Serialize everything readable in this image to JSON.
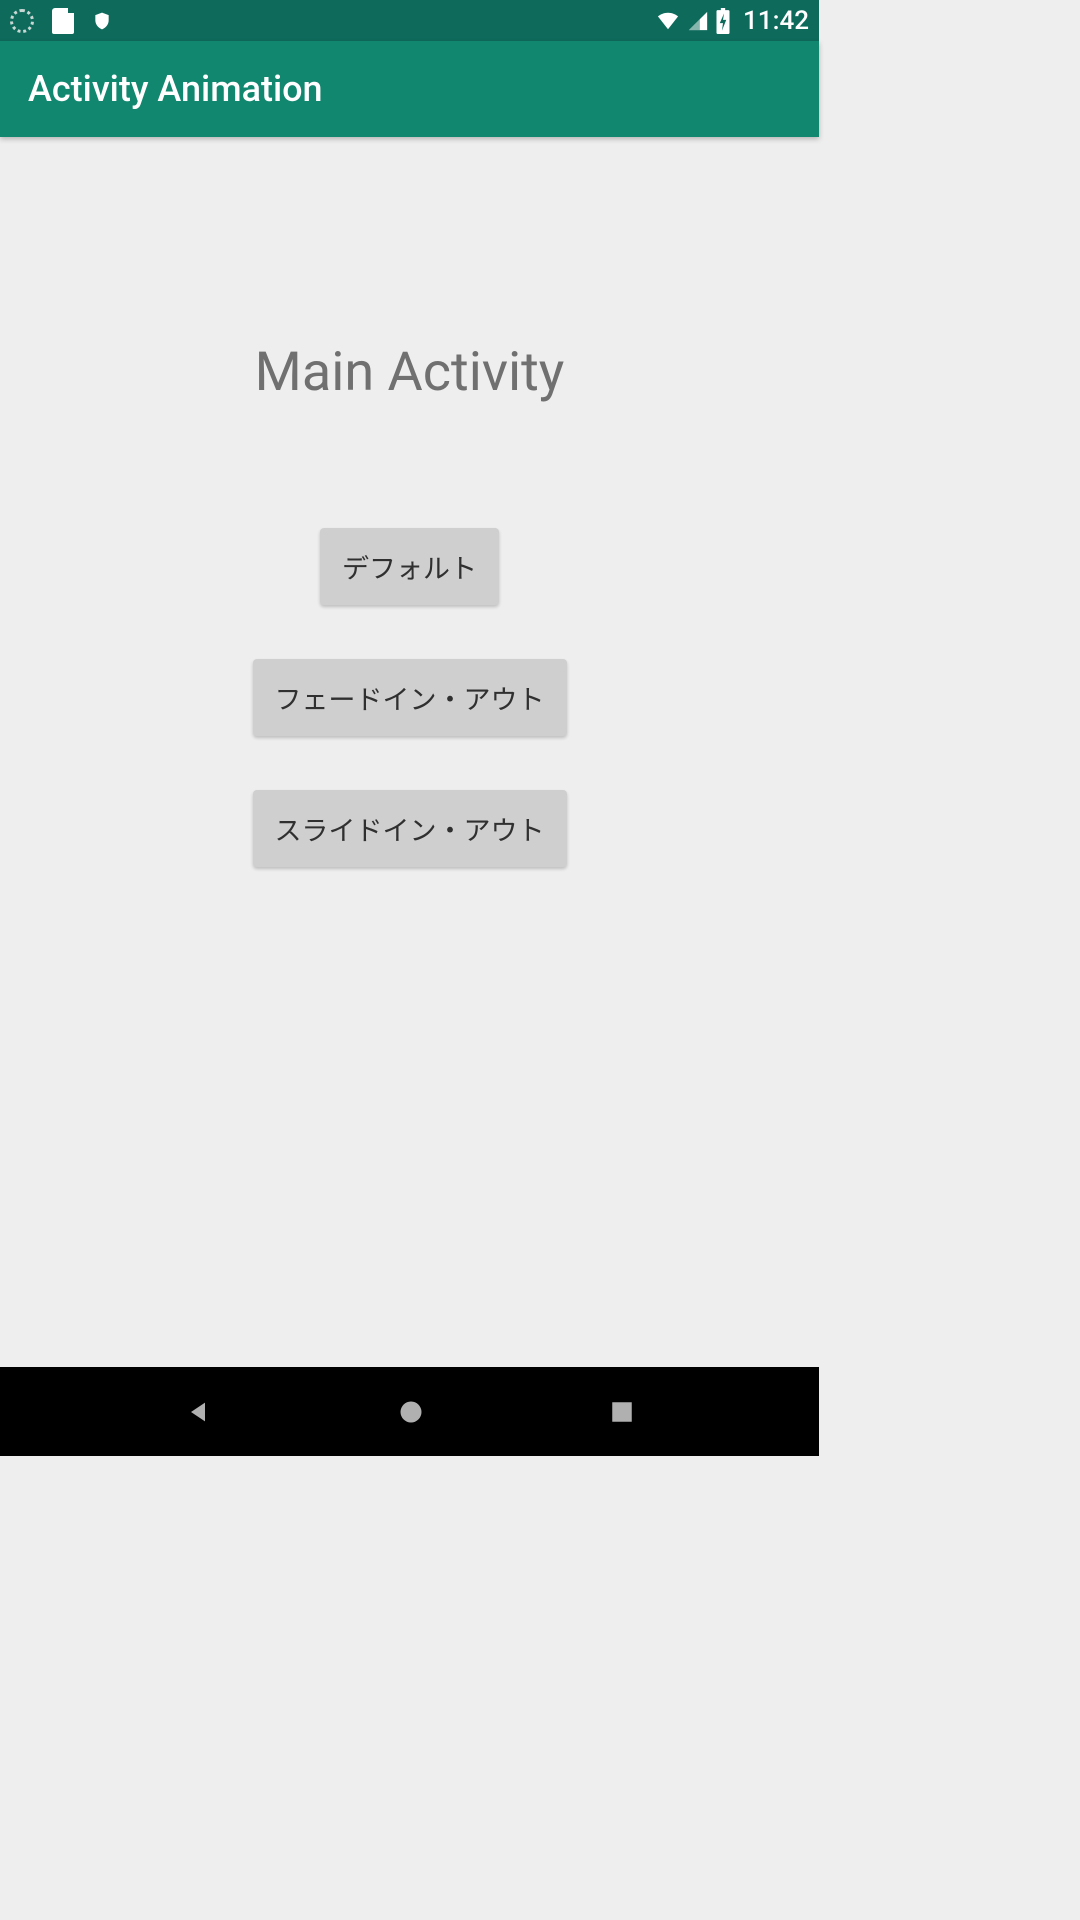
{
  "status_bar": {
    "clock": "11:42"
  },
  "app_bar": {
    "title": "Activity Animation"
  },
  "content": {
    "heading": "Main Activity",
    "buttons": {
      "default_label": "デフォルト",
      "fade_label": "フェードイン・アウト",
      "slide_label": "スライドイン・アウト"
    }
  }
}
